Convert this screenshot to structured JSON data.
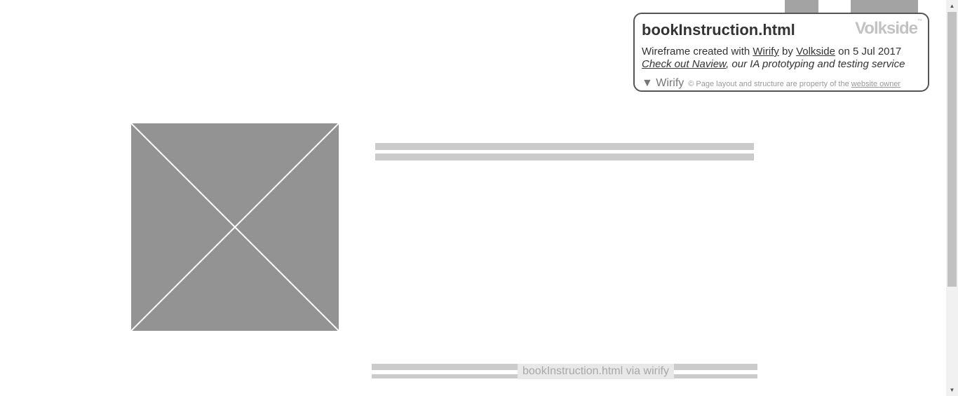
{
  "card": {
    "title": "bookInstruction.html",
    "brand": "Volkside",
    "brand_mark": "™",
    "line1": {
      "created_with": "Wireframe created with ",
      "wirify_link": "Wirify",
      "by": " by ",
      "volkside_link": "Volkside",
      "date": " on 5 Jul 2017"
    },
    "line2": {
      "naview_link": "Check out Naview",
      "rest": ", our IA prototyping and testing service"
    },
    "footer": {
      "toggle": "▼ Wirify",
      "copyright_prefix": "©  Page layout and structure are property of the ",
      "owner_link": "website owner"
    }
  },
  "watermark": "bookInstruction.html via wirify",
  "colors": {
    "placeholder": "#939393",
    "text_line": "#cbcbcb",
    "top_block": "#a3a3a3"
  },
  "scrollbar": {
    "up_icon": "triangle-up",
    "down_icon": "triangle-down",
    "up_glyph": "▲",
    "down_glyph": "▼"
  }
}
